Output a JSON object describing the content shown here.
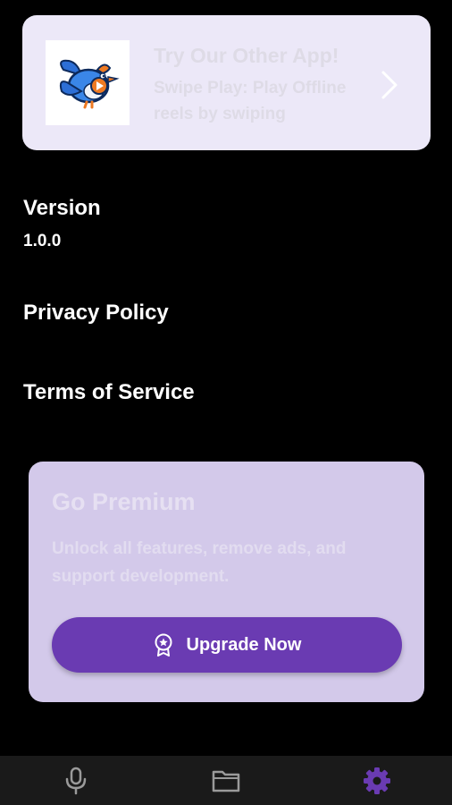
{
  "promo": {
    "title": "Try Our Other App!",
    "description": "Swipe Play: Play Offline reels by swiping",
    "icon": "bird-logo"
  },
  "settings": {
    "version_label": "Version",
    "version_value": "1.0.0",
    "privacy_label": "Privacy Policy",
    "terms_label": "Terms of Service"
  },
  "premium": {
    "title": "Go Premium",
    "description": "Unlock all features, remove ads, and support development.",
    "button_label": "Upgrade Now",
    "button_icon": "badge-star-icon"
  },
  "bottom_nav": {
    "items": [
      {
        "icon": "microphone-icon",
        "active": false
      },
      {
        "icon": "folder-icon",
        "active": false
      },
      {
        "icon": "gear-icon",
        "active": true
      }
    ]
  },
  "colors": {
    "background": "#000000",
    "promo_bg": "#ece8f8",
    "card_bg": "#d3c9ea",
    "accent": "#6a3bb2",
    "nav_bg": "#1a1a1a",
    "active_icon": "#6a3bb2",
    "inactive_icon": "#9a9a9a"
  }
}
